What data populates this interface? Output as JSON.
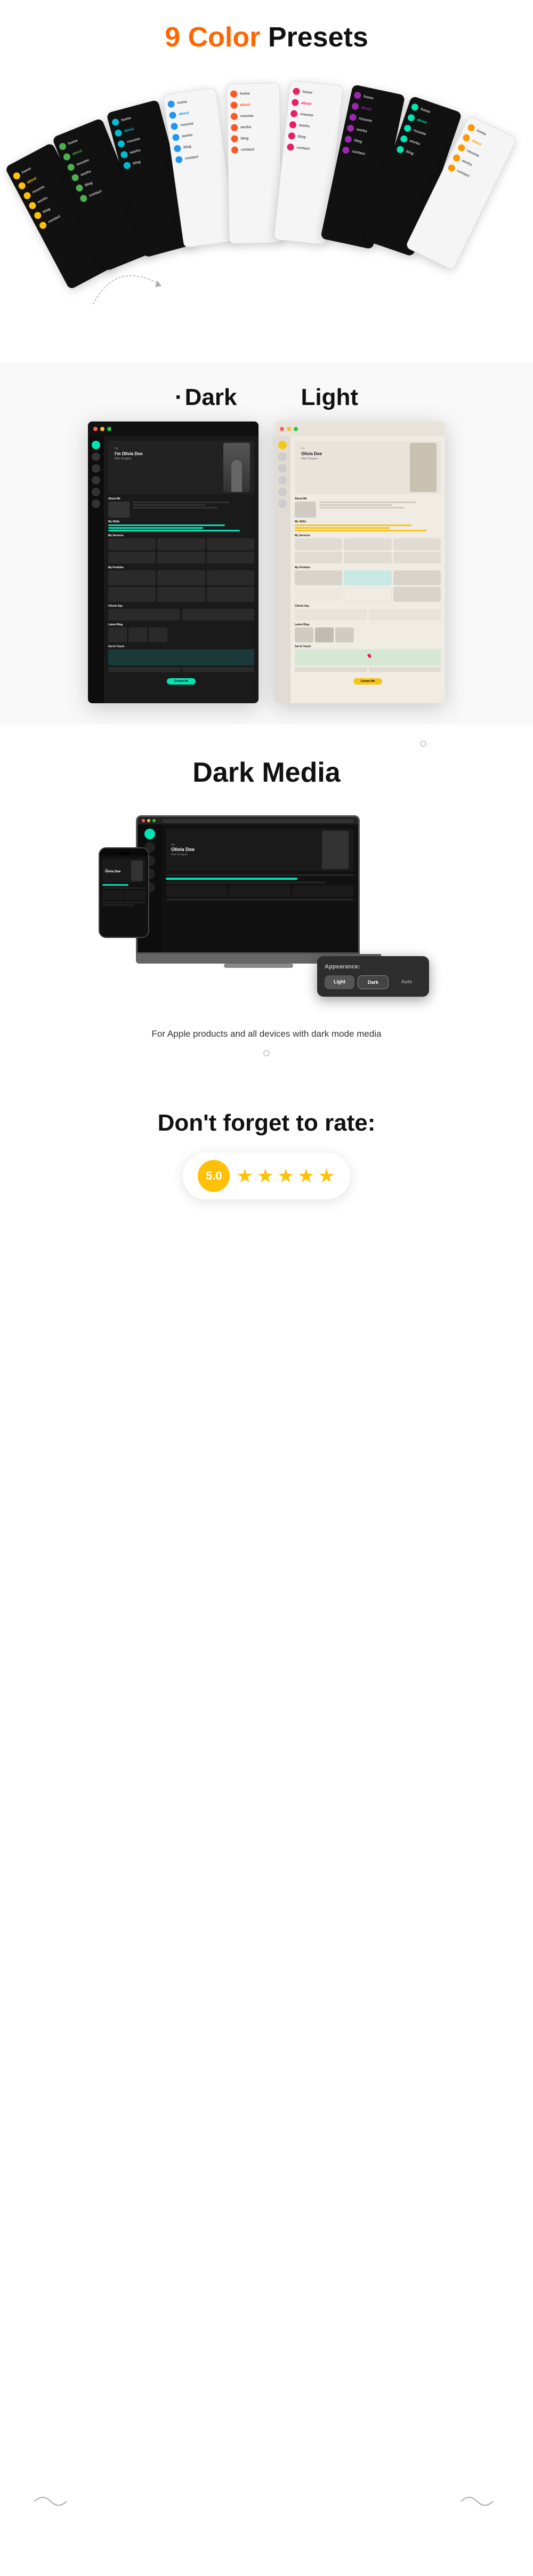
{
  "colorPresets": {
    "sectionTitle": "9 Color",
    "sectionTitle2": "Presets",
    "cards": [
      {
        "id": 1,
        "theme": "dark",
        "accentColor": "#ffc107",
        "navItems": [
          "home",
          "about",
          "resume",
          "works",
          "blog",
          "contact"
        ]
      },
      {
        "id": 2,
        "theme": "dark",
        "accentColor": "#4caf50",
        "navItems": [
          "home",
          "about",
          "resume",
          "works",
          "blog",
          "contact"
        ]
      },
      {
        "id": 3,
        "theme": "dark",
        "accentColor": "#00bcd4",
        "navItems": [
          "home",
          "about",
          "resume",
          "works",
          "blog",
          "contact"
        ]
      },
      {
        "id": 4,
        "theme": "light",
        "accentColor": "#2196f3",
        "navItems": [
          "home",
          "about",
          "resume",
          "works",
          "blog",
          "contact"
        ]
      },
      {
        "id": 5,
        "theme": "light",
        "accentColor": "#ff5722",
        "navItems": [
          "home",
          "about",
          "resume",
          "works",
          "blog",
          "contact"
        ]
      },
      {
        "id": 6,
        "theme": "light",
        "accentColor": "#e91e63",
        "navItems": [
          "home",
          "about",
          "resume",
          "works",
          "blog",
          "contact"
        ]
      },
      {
        "id": 7,
        "theme": "dark",
        "accentColor": "#9c27b0",
        "navItems": [
          "home",
          "about",
          "resume",
          "works",
          "blog",
          "contact"
        ]
      },
      {
        "id": 8,
        "theme": "dark",
        "accentColor": "#00e5b4",
        "navItems": [
          "home",
          "about",
          "resume",
          "works",
          "blog",
          "contact"
        ]
      },
      {
        "id": 9,
        "theme": "light",
        "accentColor": "#ff9800",
        "navItems": [
          "home",
          "about",
          "resume",
          "works",
          "blog",
          "contact"
        ]
      }
    ]
  },
  "modeComparison": {
    "darkLabel": "Dark",
    "lightLabel": "Light",
    "dotDecorator": "·"
  },
  "darkMedia": {
    "title": "Dark Media",
    "description": "For Apple products and all devices with dark mode media",
    "appearancePanel": {
      "title": "Appearance:",
      "options": [
        "Light",
        "Dark",
        "Auto"
      ],
      "activeOption": "Dark"
    }
  },
  "rating": {
    "title": "Don't forget to rate:",
    "score": "5.0",
    "stars": [
      "★",
      "★",
      "★",
      "★",
      "★"
    ]
  },
  "mockup": {
    "heroPerson": "I'm Olivia Doe",
    "heroTitle": "Web Designer",
    "sections": [
      "About Me",
      "My Skills",
      "My Services",
      "My Portfolio",
      "Clients Say",
      "Latest Blog",
      "Get In Touch"
    ]
  }
}
